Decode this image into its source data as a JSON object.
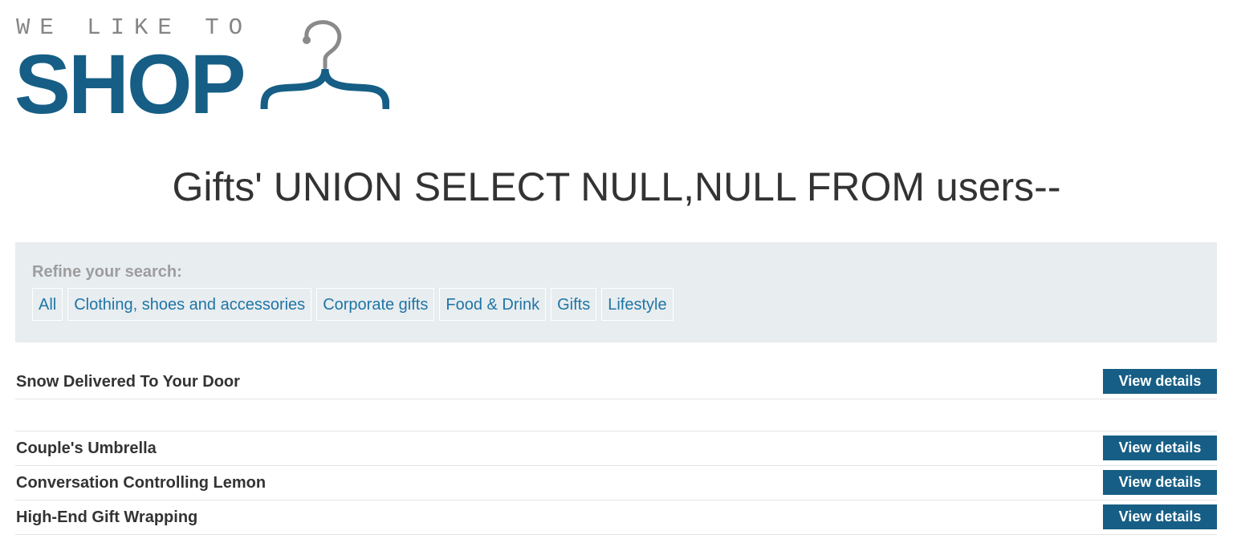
{
  "logo": {
    "tagline": "WE LIKE TO",
    "word": "SHOP"
  },
  "title": "Gifts' UNION SELECT NULL,NULL FROM users--",
  "refine": {
    "label": "Refine your search:",
    "filters": [
      "All",
      "Clothing, shoes and accessories",
      "Corporate gifts",
      "Food & Drink",
      "Gifts",
      "Lifestyle"
    ]
  },
  "products": [
    {
      "name": "Snow Delivered To Your Door",
      "button": "View details"
    },
    {
      "name": "",
      "button": ""
    },
    {
      "name": "Couple's Umbrella",
      "button": "View details"
    },
    {
      "name": "Conversation Controlling Lemon",
      "button": "View details"
    },
    {
      "name": "High-End Gift Wrapping",
      "button": "View details"
    }
  ],
  "colors": {
    "brand": "#165e85",
    "link": "#1f75a5",
    "refine_bg": "#e8edf0",
    "logo_gray": "#858585"
  }
}
